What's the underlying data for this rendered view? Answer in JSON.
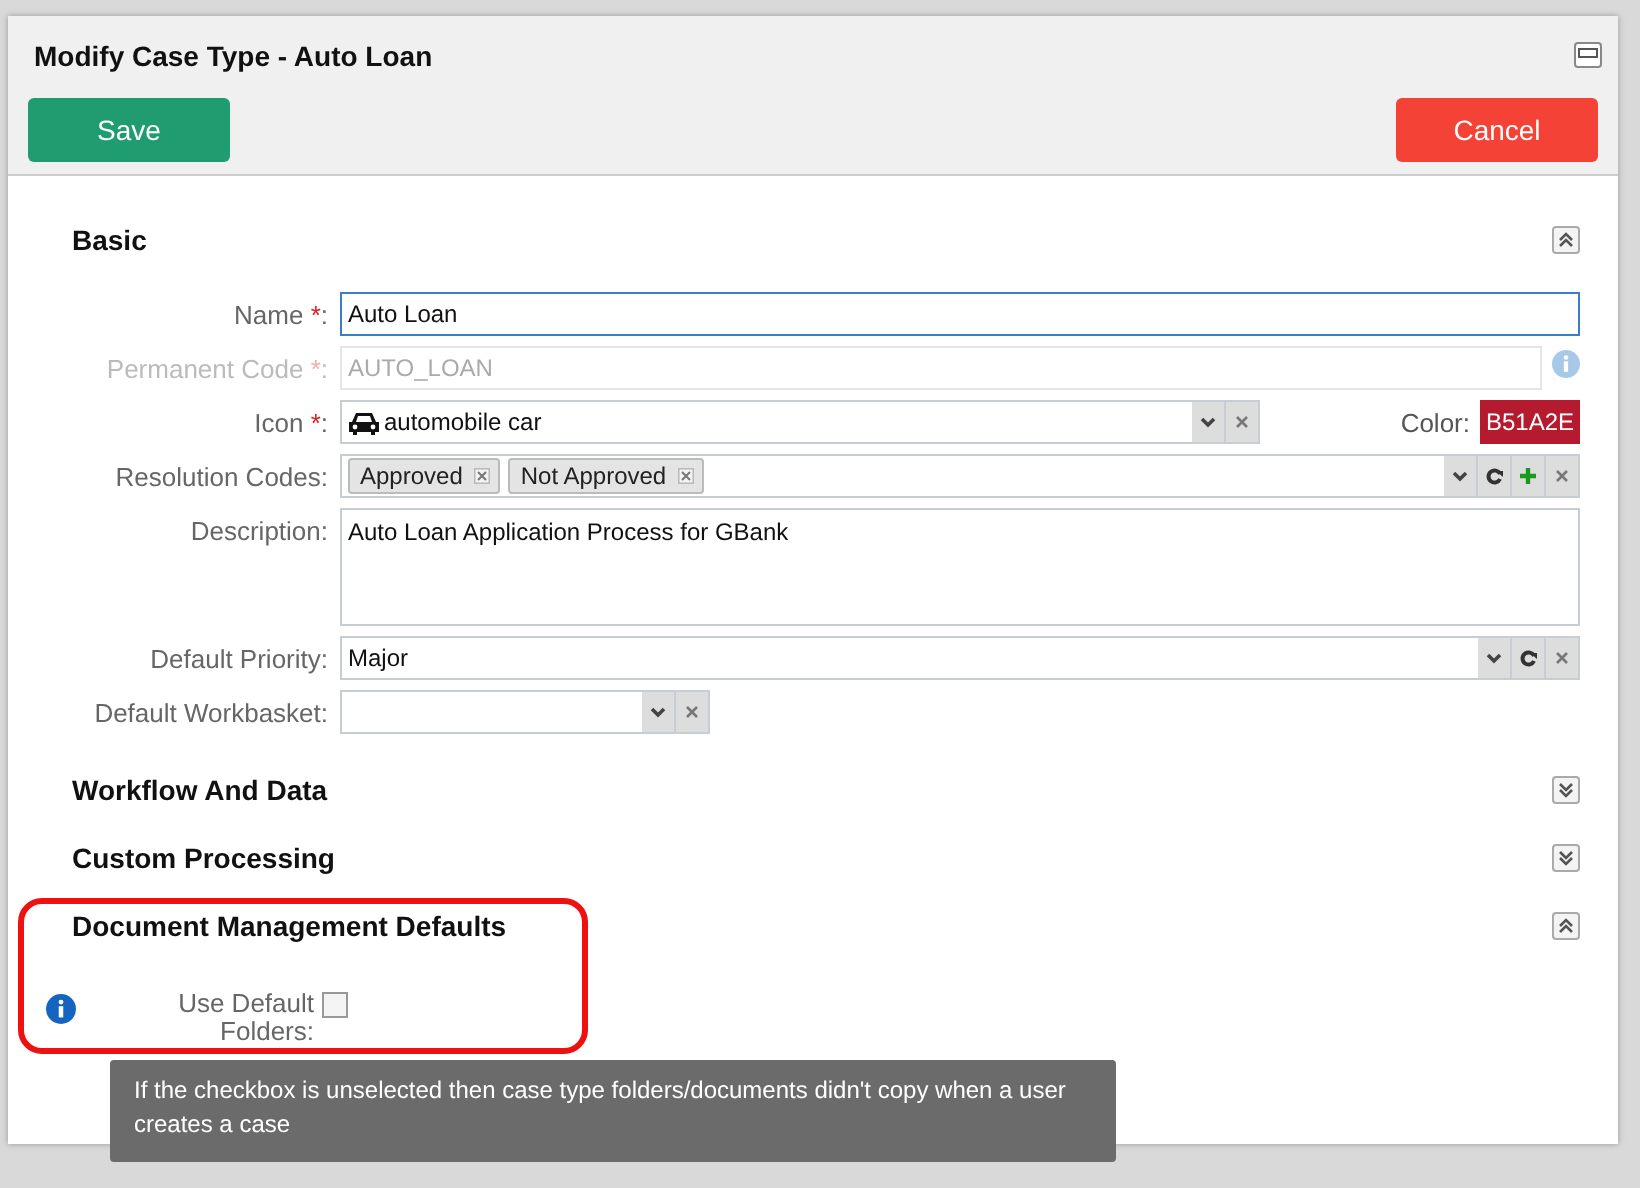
{
  "window": {
    "title": "Modify Case Type - Auto Loan"
  },
  "buttons": [
    {
      "label": "Save",
      "kind": "primary"
    },
    {
      "label": "Cancel",
      "kind": "danger"
    }
  ],
  "sections": [
    {
      "title": "Basic",
      "expanded": true,
      "highlighted": false,
      "fields": [
        {
          "kind": "text",
          "label": "Name ",
          "required_mark": "*",
          "label_end": ":",
          "value": "Auto Loan",
          "focused": true,
          "disabled": false
        },
        {
          "kind": "text",
          "label": "Permanent Code ",
          "required_mark": "*",
          "label_end": ":",
          "value": "AUTO_LOAN",
          "focused": false,
          "disabled": true,
          "info": true
        },
        {
          "kind": "select",
          "label": "Icon ",
          "required_mark": "*",
          "label_end": ":",
          "value": "automobile car",
          "color_label": "Color:",
          "color_value": "B51A2E",
          "color": "#b51a2e"
        },
        {
          "kind": "tags",
          "label": "Resolution Codes:",
          "tags": [
            "Approved",
            "Not Approved"
          ],
          "refresh": true,
          "add": true
        },
        {
          "kind": "textarea",
          "label": "Description:",
          "value": "Auto Loan Application Process for GBank"
        },
        {
          "kind": "select",
          "label": "Default Priority:",
          "value": "Major",
          "refresh": true
        },
        {
          "kind": "select",
          "label": "Default Workbasket:"
        }
      ]
    },
    {
      "title": "Workflow And Data",
      "expanded": false,
      "highlighted": false
    },
    {
      "title": "Custom Processing",
      "expanded": false,
      "highlighted": false
    },
    {
      "title": "Document Management Defaults",
      "expanded": true,
      "highlighted": true,
      "fields": [
        {
          "kind": "checkbox",
          "label": "Use Default Folders:",
          "checked": false,
          "info": true
        }
      ]
    }
  ],
  "tooltip": {
    "text": "If the checkbox is unselected then case type folders/documents didn't copy when a user creates a case"
  }
}
